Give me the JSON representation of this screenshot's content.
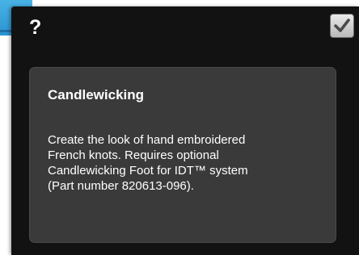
{
  "dialog": {
    "help_symbol": "?",
    "confirm_icon": "checkmark-icon",
    "title": "Candlewicking",
    "description": "Create the look of hand embroidered\nFrench knots. Requires optional\nCandlewicking Foot for IDT™ system\n(Part number 820613-096)."
  },
  "colors": {
    "dialog_background": "#121212",
    "panel_background": "#3a3a3a",
    "accent": "#2a93cf",
    "text": "#ffffff"
  }
}
